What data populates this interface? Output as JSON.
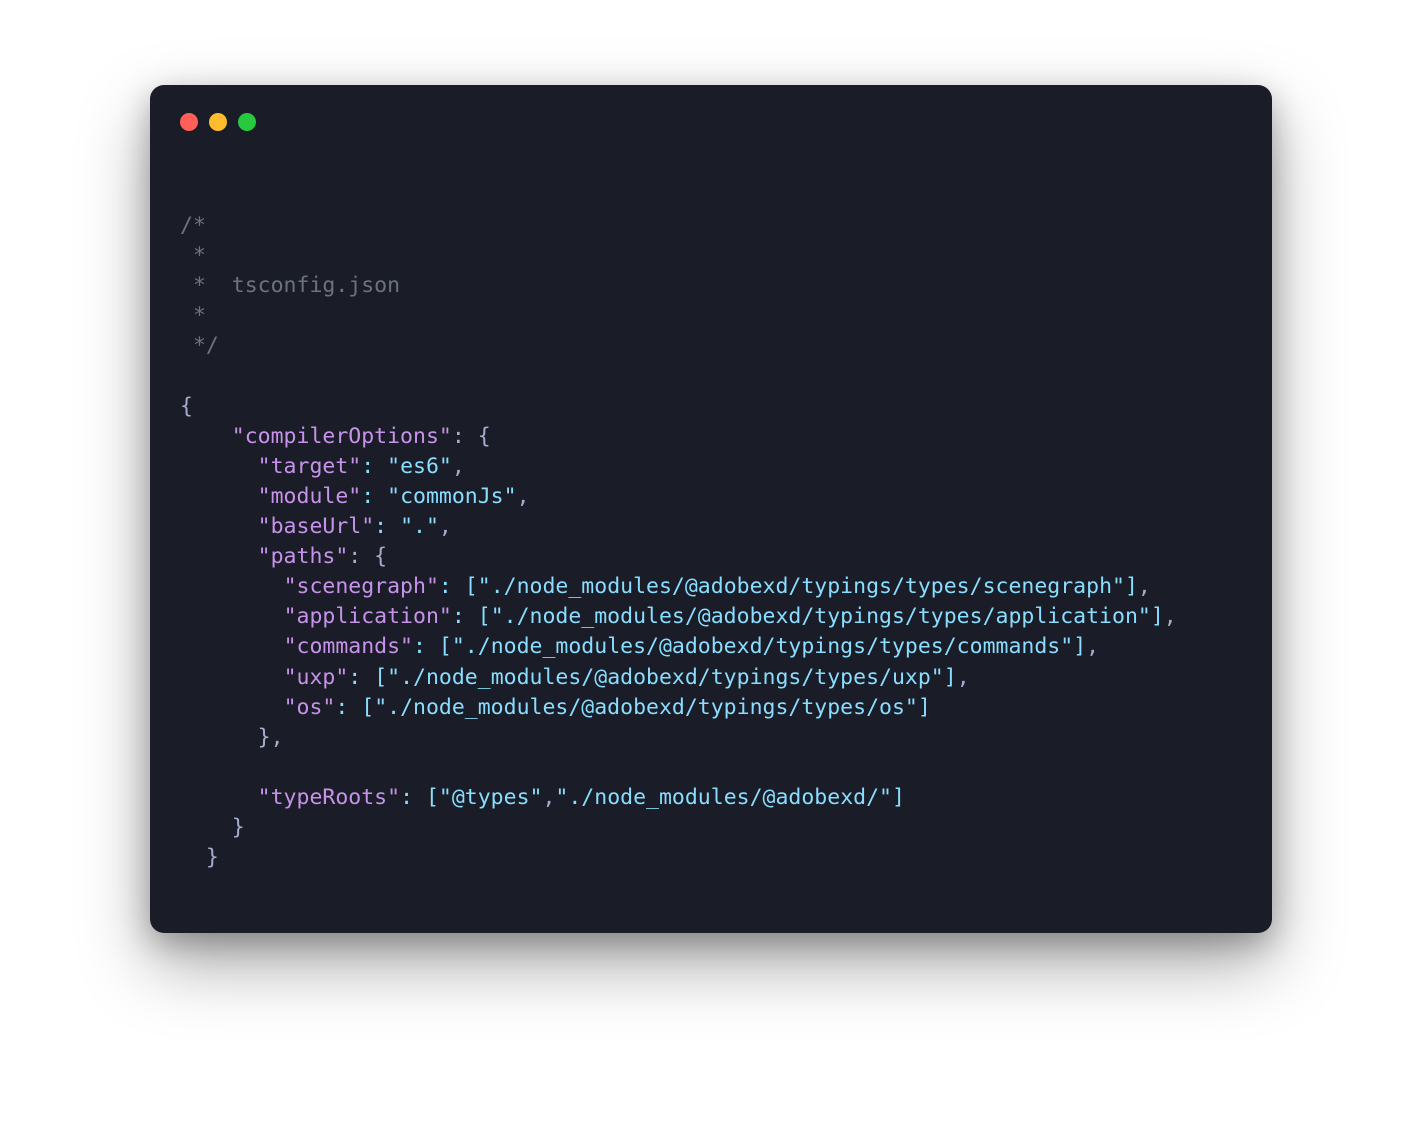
{
  "window": {
    "traffic_lights": [
      "close",
      "minimize",
      "zoom"
    ]
  },
  "code": {
    "comment_lines": [
      "/*",
      " *",
      " *  tsconfig.json",
      " *",
      " */"
    ],
    "open_brace": "{",
    "compilerOptions_key": "\"compilerOptions\"",
    "compilerOptions_open": ": {",
    "target_key": "\"target\"",
    "target_val": "\"es6\"",
    "module_key": "\"module\"",
    "module_val": "\"commonJs\"",
    "baseUrl_key": "\"baseUrl\"",
    "baseUrl_val": "\".\"",
    "paths_key": "\"paths\"",
    "paths_open": ": {",
    "paths": {
      "scenegraph_key": "\"scenegraph\"",
      "scenegraph_val": "\"./node_modules/@adobexd/typings/types/scenegraph\"",
      "application_key": "\"application\"",
      "application_val": "\"./node_modules/@adobexd/typings/types/application\"",
      "commands_key": "\"commands\"",
      "commands_val": "\"./node_modules/@adobexd/typings/types/commands\"",
      "uxp_key": "\"uxp\"",
      "uxp_val": "\"./node_modules/@adobexd/typings/types/uxp\"",
      "os_key": "\"os\"",
      "os_val": "\"./node_modules/@adobexd/typings/types/os\""
    },
    "paths_close": "},",
    "typeRoots_key": "\"typeRoots\"",
    "typeRoots_val1": "\"@types\"",
    "typeRoots_val2": "\"./node_modules/@adobexd/\"",
    "compilerOptions_close": "}",
    "close_brace": "}"
  }
}
